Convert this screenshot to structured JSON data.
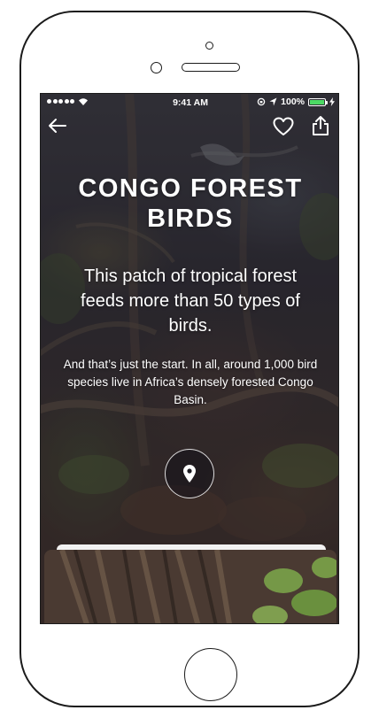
{
  "status_bar": {
    "time": "9:41 AM",
    "battery": "100%"
  },
  "nav": {
    "back_icon": "arrow-left-icon",
    "favorite_icon": "heart-icon",
    "share_icon": "share-icon"
  },
  "content": {
    "title": "CONGO FOREST BIRDS",
    "subtitle": "This patch of tropical forest feeds more than 50 types of birds.",
    "body": "And that’s just the start. In all, around 1,000 bird species live in Africa’s densely forested Congo Basin."
  },
  "location_button": {
    "icon": "map-pin-icon"
  },
  "colors": {
    "text": "#ffffff",
    "battery_fill": "#4cd964",
    "frame": "#1b1b1b"
  }
}
